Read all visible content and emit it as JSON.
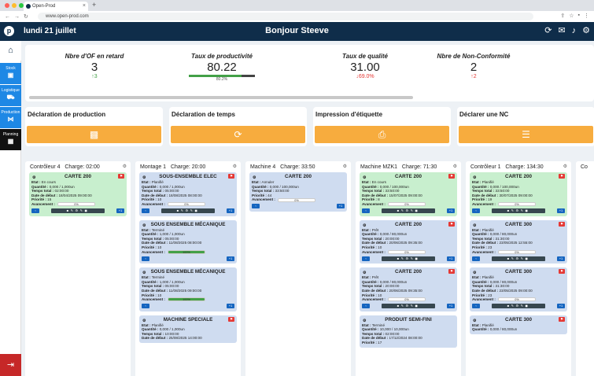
{
  "browser": {
    "tab_title": "Open-Prod",
    "url": "www.open-prod.com"
  },
  "header": {
    "date": "lundi 21 juillet",
    "greeting": "Bonjour Steeve"
  },
  "sidebar": {
    "items": [
      {
        "label": "Stock",
        "color": "#1e88e5"
      },
      {
        "label": "Logistique",
        "color": "#1e88e5"
      },
      {
        "label": "Production",
        "color": "#1e88e5"
      },
      {
        "label": "Planning",
        "color": "#111111"
      }
    ]
  },
  "kpis": [
    {
      "title": "Nbre d'OF en retard",
      "value": "3",
      "delta": "3",
      "direction": "up",
      "delta_color": "#43a047"
    },
    {
      "title": "Taux de productivité",
      "value": "80.22",
      "delta": "80.2%",
      "bar_fraction": 0.802
    },
    {
      "title": "Taux de qualité",
      "value": "31.00",
      "delta": "69.0%",
      "direction": "down",
      "delta_color": "#e53935"
    },
    {
      "title": "Nbre de Non-Conformité",
      "value": "2",
      "delta": "2",
      "direction": "up",
      "delta_color": "#e53935"
    }
  ],
  "actions": [
    {
      "title": "Déclaration de production",
      "icon": "qr-icon"
    },
    {
      "title": "Déclaration de temps",
      "icon": "refresh-icon"
    },
    {
      "title": "Impression d'étiquette",
      "icon": "printer-icon"
    },
    {
      "title": "Déclarer une NC",
      "icon": "form-icon"
    }
  ],
  "labels": {
    "etat": "Etat :",
    "quantite": "Quantité :",
    "temps": "Temps total :",
    "date": "Date de début :",
    "priorite": "Priorité :",
    "avancement": "Avancement :"
  },
  "columns": [
    {
      "name": "Contrôleur 4",
      "charge": "Charge: 02:00",
      "cards": [
        {
          "title": "CARTE 200",
          "color": "green",
          "alert": true,
          "etat": "En cours",
          "quantite": "0,000 / 1,000un",
          "temps": "02:00:00",
          "date": "18/04/2025 09:00:00",
          "priorite": "15",
          "avancement": "0%",
          "progress": 0,
          "tools": true
        }
      ]
    },
    {
      "name": "Montage 1",
      "charge": "Charge: 20:00",
      "cards": [
        {
          "title": "SOUS-ENSEMBLE ELEC",
          "color": "blue",
          "alert": true,
          "etat": "Planifié",
          "quantite": "0,000 / 1,000un",
          "temps": "05:00:00",
          "date": "18/08/2025 08:00:00",
          "priorite": "10",
          "avancement": "0%",
          "progress": 0,
          "tools": true
        },
        {
          "title": "SOUS ENSEMBLE MÉCANIQUE",
          "color": "blue",
          "alert": false,
          "etat": "Terminé",
          "quantite": "1,000 / 1,000un",
          "temps": "05:00:00",
          "date": "11/08/2025 08:00:00",
          "priorite": "10",
          "avancement": "100%",
          "progress": 1,
          "tools": false
        },
        {
          "title": "SOUS ENSEMBLE MÉCANIQUE",
          "color": "blue",
          "alert": false,
          "etat": "Terminé",
          "quantite": "1,000 / 1,000un",
          "temps": "05:00:00",
          "date": "11/08/2025 09:00:00",
          "priorite": "10",
          "avancement": "100%",
          "progress": 1,
          "tools": false
        },
        {
          "title": "MACHINE SPECIALE",
          "color": "blue",
          "alert": true,
          "etat": "Planifié",
          "quantite": "0,000 / 1,000un",
          "temps": "10:00:00",
          "date": "25/08/2025 14:00:00",
          "priorite": "",
          "avancement": "",
          "progress": 0,
          "tools": false
        }
      ]
    },
    {
      "name": "Machine 4",
      "charge": "Charge: 33:50",
      "cards": [
        {
          "title": "CARTE 200",
          "color": "blue",
          "alert": false,
          "etat": "Annuler",
          "quantite": "0,000 / 100,000un",
          "temps": "33:50:00",
          "date": "",
          "priorite": "44",
          "avancement": "0%",
          "progress": 0,
          "tools": false
        }
      ]
    },
    {
      "name": "Machine MZK1",
      "charge": "Charge: 71:30",
      "cards": [
        {
          "title": "CARTE 200",
          "color": "green",
          "alert": true,
          "etat": "En cours",
          "quantite": "0,000 / 100,000un",
          "temps": "33:50:00",
          "date": "15/07/2025 09:00:00",
          "priorite": "8",
          "avancement": "0%",
          "progress": 0,
          "tools": true
        },
        {
          "title": "CARTE 200",
          "color": "blue",
          "alert": true,
          "etat": "Prêt",
          "quantite": "0,000 / 80,000un",
          "temps": "20:00:00",
          "date": "20/06/2025 09:35:00",
          "priorite": "10",
          "avancement": "0%",
          "progress": 0,
          "tools": true
        },
        {
          "title": "CARTE 200",
          "color": "blue",
          "alert": true,
          "etat": "Prêt",
          "quantite": "0,000 / 80,000un",
          "temps": "20:00:00",
          "date": "20/06/2025 09:35:00",
          "priorite": "10",
          "avancement": "0%",
          "progress": 0,
          "tools": true
        },
        {
          "title": "PRODUIT SEMI-FINI",
          "color": "blue",
          "alert": false,
          "etat": "Terminé",
          "quantite": "10,000 / 10,000un",
          "temps": "02:00:00",
          "date": "17/12/2024 08:00:00",
          "priorite": "17",
          "avancement": "",
          "progress": 0,
          "tools": false
        }
      ]
    },
    {
      "name": "Contrôleur 1",
      "charge": "Charge: 134:30",
      "cards": [
        {
          "title": "CARTE 200",
          "color": "green",
          "alert": true,
          "etat": "Planifié",
          "quantite": "0,000 / 100,000un",
          "temps": "33:50:00",
          "date": "30/07/2025 09:00:00",
          "priorite": "19",
          "avancement": "0%",
          "progress": 0,
          "tools": true
        },
        {
          "title": "CARTE 300",
          "color": "blue",
          "alert": true,
          "etat": "Planifié",
          "quantite": "0,000 / 80,000un",
          "temps": "31:30:00",
          "date": "23/05/2025 12:55:00",
          "priorite": "23",
          "avancement": "0%",
          "progress": 0,
          "tools": true
        },
        {
          "title": "CARTE 300",
          "color": "blue",
          "alert": true,
          "etat": "Planifié",
          "quantite": "0,000 / 80,000un",
          "temps": "31:30:00",
          "date": "23/05/2025 09:00:00",
          "priorite": "23",
          "avancement": "0%",
          "progress": 0,
          "tools": true
        },
        {
          "title": "CARTE 300",
          "color": "blue",
          "alert": true,
          "etat": "Planifié",
          "quantite": "0,000 / 80,000un",
          "temps": "",
          "date": "",
          "priorite": "",
          "avancement": "",
          "progress": 0,
          "tools": false
        }
      ]
    },
    {
      "name": "Co",
      "charge": "",
      "cards": []
    }
  ]
}
